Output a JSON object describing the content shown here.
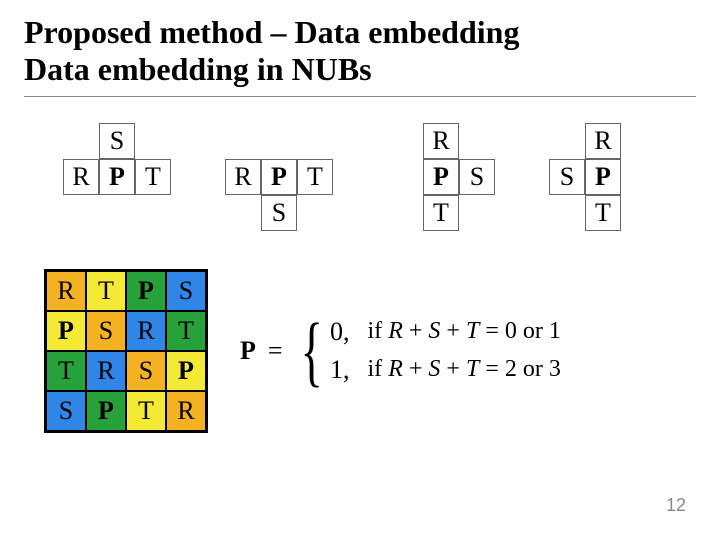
{
  "title_line1": "Proposed method – Data embedding",
  "title_line2": "Data embedding in NUBs",
  "pagenum": "12",
  "nub_labels": {
    "S": "S",
    "R": "R",
    "P": "P",
    "T": "T"
  },
  "grid": [
    [
      {
        "t": "R",
        "c": "o",
        "b": false
      },
      {
        "t": "T",
        "c": "y",
        "b": false
      },
      {
        "t": "P",
        "c": "g",
        "b": true
      },
      {
        "t": "S",
        "c": "b",
        "b": false
      }
    ],
    [
      {
        "t": "P",
        "c": "y",
        "b": true
      },
      {
        "t": "S",
        "c": "o",
        "b": false
      },
      {
        "t": "R",
        "c": "b",
        "b": false
      },
      {
        "t": "T",
        "c": "g",
        "b": false
      }
    ],
    [
      {
        "t": "T",
        "c": "g",
        "b": false
      },
      {
        "t": "R",
        "c": "b",
        "b": false
      },
      {
        "t": "S",
        "c": "o",
        "b": false
      },
      {
        "t": "P",
        "c": "y",
        "b": true
      }
    ],
    [
      {
        "t": "S",
        "c": "b",
        "b": false
      },
      {
        "t": "P",
        "c": "g",
        "b": true
      },
      {
        "t": "T",
        "c": "y",
        "b": false
      },
      {
        "t": "R",
        "c": "o",
        "b": false
      }
    ]
  ],
  "equation": {
    "lhs": "P",
    "cases": [
      {
        "value": "0,",
        "cond": "if R + S + T = 0 or 1"
      },
      {
        "value": "1,",
        "cond": "if R + S + T = 2 or 3"
      }
    ]
  }
}
